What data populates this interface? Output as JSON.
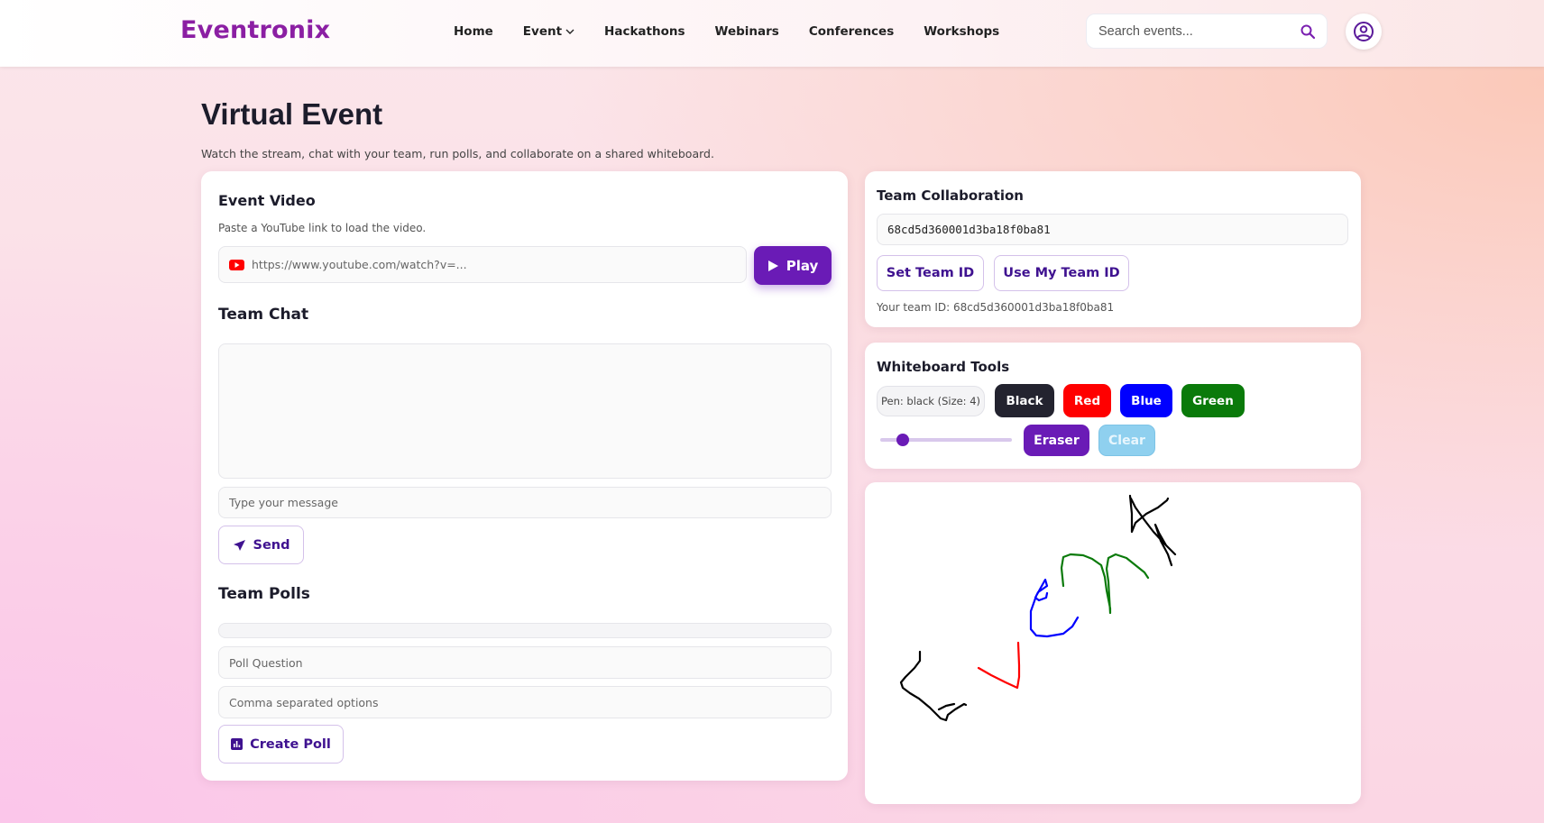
{
  "header": {
    "brand": "Eventronix",
    "nav": [
      {
        "label": "Home"
      },
      {
        "label": "Event"
      },
      {
        "label": "Hackathons"
      },
      {
        "label": "Webinars"
      },
      {
        "label": "Conferences"
      },
      {
        "label": "Workshops"
      }
    ],
    "search_placeholder": "Search events...",
    "search_icon": "search-icon",
    "avatar_icon": "user-circle-icon"
  },
  "page": {
    "title": "Virtual Event",
    "subtitle": "Watch the stream, chat with your team, run polls, and collaborate on a shared whiteboard."
  },
  "video": {
    "title": "Event Video",
    "hint": "Paste a YouTube link to load the video.",
    "url_placeholder": "https://www.youtube.com/watch?v=...",
    "play_label": "Play",
    "url_icon": "youtube-icon"
  },
  "chat": {
    "title": "Team Chat",
    "message_placeholder": "Type your message",
    "send_label": "Send",
    "send_icon": "paper-plane-icon"
  },
  "polls": {
    "title": "Team Polls",
    "question_placeholder": "Poll Question",
    "options_placeholder": "Comma separated options",
    "create_label": "Create Poll",
    "create_icon": "bar-chart-icon"
  },
  "team": {
    "title": "Team Collaboration",
    "team_id_value": "68cd5d360001d3ba18f0ba81",
    "set_label": "Set Team ID",
    "use_label": "Use My Team ID",
    "your_id_text": "Your team ID: 68cd5d360001d3ba18f0ba81"
  },
  "whiteboard": {
    "title": "Whiteboard Tools",
    "pen_status": "Pen: black (Size: 4)",
    "colors": [
      {
        "label": "Black",
        "color": "#23232f"
      },
      {
        "label": "Red",
        "color": "#ff0000"
      },
      {
        "label": "Blue",
        "color": "#0000ff"
      },
      {
        "label": "Green",
        "color": "#0a7a0a"
      }
    ],
    "pen_size": 4,
    "eraser_label": "Eraser",
    "clear_label": "Clear"
  },
  "colors": {
    "brand": "#8b1fa3",
    "primary": "#6a1bb6",
    "clear_button": "#8fd0ef"
  }
}
